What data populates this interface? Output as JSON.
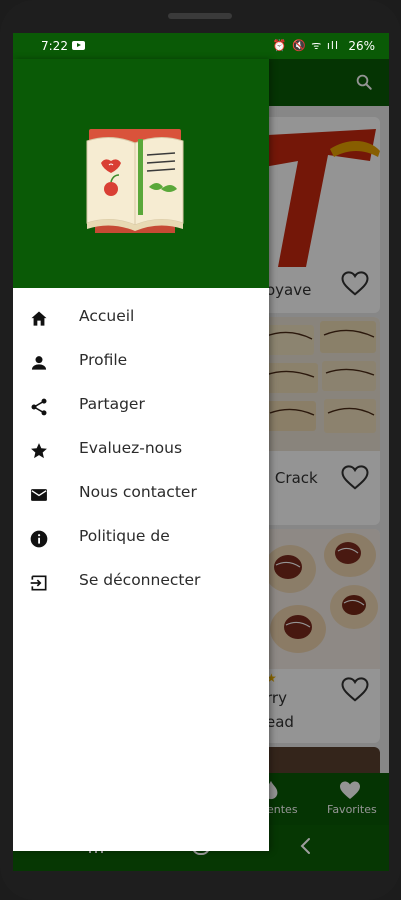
{
  "status_bar": {
    "time": "7:22",
    "icons": "⏰ 🔇 ᯤ ıll",
    "battery": "26%"
  },
  "drawer": {
    "menu_items": [
      {
        "label": "Accueil",
        "icon": "home-icon"
      },
      {
        "label": "Profile",
        "icon": "person-icon"
      },
      {
        "label": "Partager",
        "icon": "share-icon"
      },
      {
        "label": "Evaluez-nous",
        "icon": "star-icon"
      },
      {
        "label": "Nous contacter",
        "icon": "mail-icon"
      },
      {
        "label": "Politique de",
        "icon": "info-icon"
      },
      {
        "label": "Se déconnecter",
        "icon": "logout-icon"
      }
    ]
  },
  "background": {
    "cards": [
      {
        "text_line1": "oyave",
        "text_line2": ""
      },
      {
        "text_line1": "l Crack",
        "text_line2": ""
      },
      {
        "text_line1": "rry",
        "text_line2": "ead"
      }
    ],
    "bottom_nav": {
      "item1": "entes",
      "item2": "Favorites"
    }
  },
  "colors": {
    "primary": "#0a5a06",
    "drawer_bg": "#ffffff",
    "text": "#2b2b2b"
  }
}
